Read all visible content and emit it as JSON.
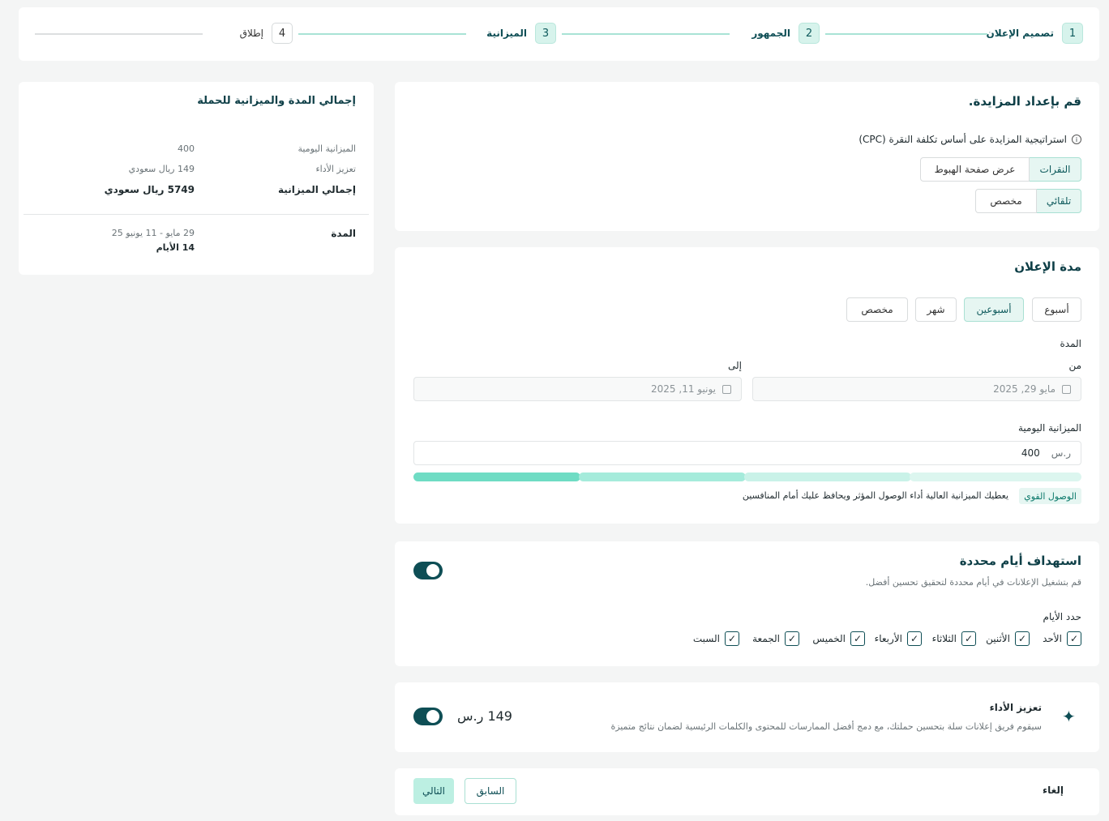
{
  "stepper": {
    "steps": [
      {
        "num": "1",
        "label": "تصميم الإعلان"
      },
      {
        "num": "2",
        "label": "الجمهور"
      },
      {
        "num": "3",
        "label": "الميزانية"
      },
      {
        "num": "4",
        "label": "إطلاق"
      }
    ]
  },
  "bidding": {
    "title": "قم بإعداد المزايدة.",
    "strategy_label": "استراتيجية المزايدة على أساس تكلفة النقرة (CPC)",
    "type_options": [
      "النقرات",
      "عرض صفحة الهبوط"
    ],
    "mode_options": [
      "تلقائي",
      "مخصص"
    ]
  },
  "duration": {
    "title": "مدة الإعلان",
    "presets": [
      "أسبوع",
      "أسبوعين",
      "شهر",
      "مخصص"
    ],
    "period_label": "المدة",
    "from_label": "من",
    "to_label": "إلى",
    "from_value": "مايو 29, 2025",
    "to_value": "يونيو 11, 2025",
    "daily_budget_label": "الميزانية اليومية",
    "currency": "ر.س",
    "daily_budget_value": "400",
    "reach_badge": "الوصول القوي",
    "reach_text": "يعطيك الميزانية العالية أداء الوصول المؤثر ويحافظ عليك أمام المنافسين",
    "reach_level": 0.25
  },
  "days": {
    "title": "استهداف أيام محددة",
    "subtitle": "قم بتشغيل الإعلانات في أيام محددة لتحقيق تحسين أفضل.",
    "select_label": "حدد الأيام",
    "items": [
      "الأحد",
      "الأثنين",
      "الثلاثاء",
      "الأربعاء",
      "الخميس",
      "الجمعة",
      "السبت"
    ]
  },
  "boost": {
    "title": "تعزيز الأداء",
    "description": "سيقوم فريق إعلانات سلة بتحسين حملتك، مع دمج أفضل الممارسات للمحتوى والكلمات الرئيسية لضمان نتائج متميزة",
    "price": "149 ر.س"
  },
  "footer": {
    "cancel": "إلغاء",
    "previous": "السابق",
    "next": "التالي"
  },
  "summary": {
    "title": "إجمالي المدة والميزانية للحملة",
    "daily_label": "الميزانية اليومية",
    "daily_value": "400",
    "boost_label": "تعزيز الأداء",
    "boost_value": "149 ريال سعودي",
    "total_label": "إجمالي الميزانية",
    "total_value": "5749 ريال سعودي",
    "duration_label": "المدة",
    "duration_range": "29 مايو - 11 يونيو 25",
    "duration_days": "14 الأيام"
  },
  "colors": {
    "primary": "#0e4e55",
    "accent": "#6fdcc4",
    "accent_light": "#e6f6f2"
  }
}
